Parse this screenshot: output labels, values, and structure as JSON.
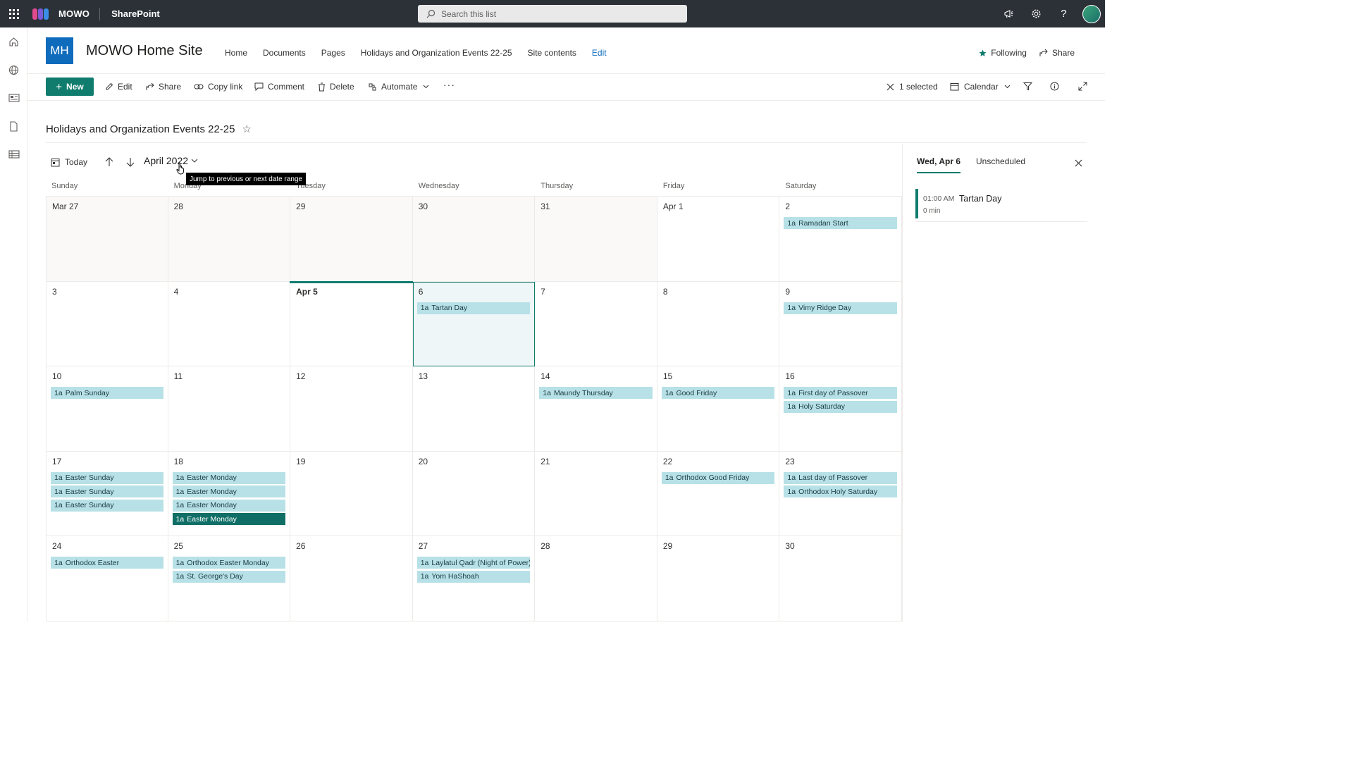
{
  "suitebar": {
    "brand": "MOWO",
    "app": "SharePoint",
    "search_placeholder": "Search this list",
    "icons": [
      "megaphone-icon",
      "gear-icon",
      "help-icon",
      "avatar"
    ]
  },
  "leftrail": {
    "icons": [
      "home-icon",
      "globe-icon",
      "news-icon",
      "file-icon",
      "list-icon"
    ]
  },
  "site": {
    "logo_text": "MH",
    "title": "MOWO Home Site",
    "nav": [
      {
        "label": "Home"
      },
      {
        "label": "Documents"
      },
      {
        "label": "Pages"
      },
      {
        "label": "Holidays and Organization Events 22-25"
      },
      {
        "label": "Site contents"
      }
    ],
    "edit_label": "Edit",
    "following_label": "Following",
    "share_label": "Share"
  },
  "commandbar": {
    "new_label": "New",
    "edit_label": "Edit",
    "share_label": "Share",
    "copylink_label": "Copy link",
    "comment_label": "Comment",
    "delete_label": "Delete",
    "automate_label": "Automate",
    "more_label": "···",
    "selected_label": "1 selected",
    "view_label": "Calendar"
  },
  "list": {
    "title": "Holidays and Organization Events 22-25"
  },
  "calendar": {
    "today_label": "Today",
    "month_label": "April 2022",
    "tooltip": "Jump to previous or next date range",
    "weekdays": [
      "Sunday",
      "Monday",
      "Tuesday",
      "Wednesday",
      "Thursday",
      "Friday",
      "Saturday"
    ],
    "weeks": [
      [
        {
          "label": "Mar 27",
          "other": true,
          "events": []
        },
        {
          "label": "28",
          "other": true,
          "events": []
        },
        {
          "label": "29",
          "other": true,
          "events": []
        },
        {
          "label": "30",
          "other": true,
          "events": []
        },
        {
          "label": "31",
          "other": true,
          "events": []
        },
        {
          "label": "Apr 1",
          "events": []
        },
        {
          "label": "2",
          "events": [
            {
              "time": "1a",
              "title": "Ramadan Start"
            }
          ]
        }
      ],
      [
        {
          "label": "3",
          "events": []
        },
        {
          "label": "4",
          "events": []
        },
        {
          "label": "Apr 5",
          "today": true,
          "events": []
        },
        {
          "label": "6",
          "selected": true,
          "events": [
            {
              "time": "1a",
              "title": "Tartan Day"
            }
          ]
        },
        {
          "label": "7",
          "events": []
        },
        {
          "label": "8",
          "events": []
        },
        {
          "label": "9",
          "events": [
            {
              "time": "1a",
              "title": "Vimy Ridge Day"
            }
          ]
        }
      ],
      [
        {
          "label": "10",
          "events": [
            {
              "time": "1a",
              "title": "Palm Sunday"
            }
          ]
        },
        {
          "label": "11",
          "events": []
        },
        {
          "label": "12",
          "events": []
        },
        {
          "label": "13",
          "events": []
        },
        {
          "label": "14",
          "events": [
            {
              "time": "1a",
              "title": "Maundy Thursday"
            }
          ]
        },
        {
          "label": "15",
          "events": [
            {
              "time": "1a",
              "title": "Good Friday"
            }
          ]
        },
        {
          "label": "16",
          "events": [
            {
              "time": "1a",
              "title": "First day of Passover"
            },
            {
              "time": "1a",
              "title": "Holy Saturday"
            }
          ]
        }
      ],
      [
        {
          "label": "17",
          "events": [
            {
              "time": "1a",
              "title": "Easter Sunday"
            },
            {
              "time": "1a",
              "title": "Easter Sunday"
            },
            {
              "time": "1a",
              "title": "Easter Sunday"
            }
          ]
        },
        {
          "label": "18",
          "events": [
            {
              "time": "1a",
              "title": "Easter Monday"
            },
            {
              "time": "1a",
              "title": "Easter Monday"
            },
            {
              "time": "1a",
              "title": "Easter Monday"
            },
            {
              "time": "1a",
              "title": "Easter Monday",
              "highlight": true
            }
          ]
        },
        {
          "label": "19",
          "events": []
        },
        {
          "label": "20",
          "events": []
        },
        {
          "label": "21",
          "events": []
        },
        {
          "label": "22",
          "events": [
            {
              "time": "1a",
              "title": "Orthodox Good Friday"
            }
          ]
        },
        {
          "label": "23",
          "events": [
            {
              "time": "1a",
              "title": "Last day of Passover"
            },
            {
              "time": "1a",
              "title": "Orthodox Holy Saturday"
            }
          ]
        }
      ],
      [
        {
          "label": "24",
          "events": [
            {
              "time": "1a",
              "title": "Orthodox Easter"
            }
          ]
        },
        {
          "label": "25",
          "events": [
            {
              "time": "1a",
              "title": "Orthodox Easter Monday"
            },
            {
              "time": "1a",
              "title": "St. George's Day"
            }
          ]
        },
        {
          "label": "26",
          "events": []
        },
        {
          "label": "27",
          "events": [
            {
              "time": "1a",
              "title": "Laylatul Qadr (Night of Power)"
            },
            {
              "time": "1a",
              "title": "Yom HaShoah"
            }
          ]
        },
        {
          "label": "28",
          "events": []
        },
        {
          "label": "29",
          "events": []
        },
        {
          "label": "30",
          "events": []
        }
      ]
    ]
  },
  "panel": {
    "tab_date": "Wed, Apr 6",
    "tab_unscheduled": "Unscheduled",
    "event_time": "01:00 AM",
    "event_title": "Tartan Day",
    "event_duration": "0 min"
  },
  "colors": {
    "suitebar": "#2b3137",
    "accent": "#107c6e",
    "event_bg": "#b7e1e6",
    "event_highlight": "#0f6e66",
    "site_logo": "#0f6cbd"
  }
}
